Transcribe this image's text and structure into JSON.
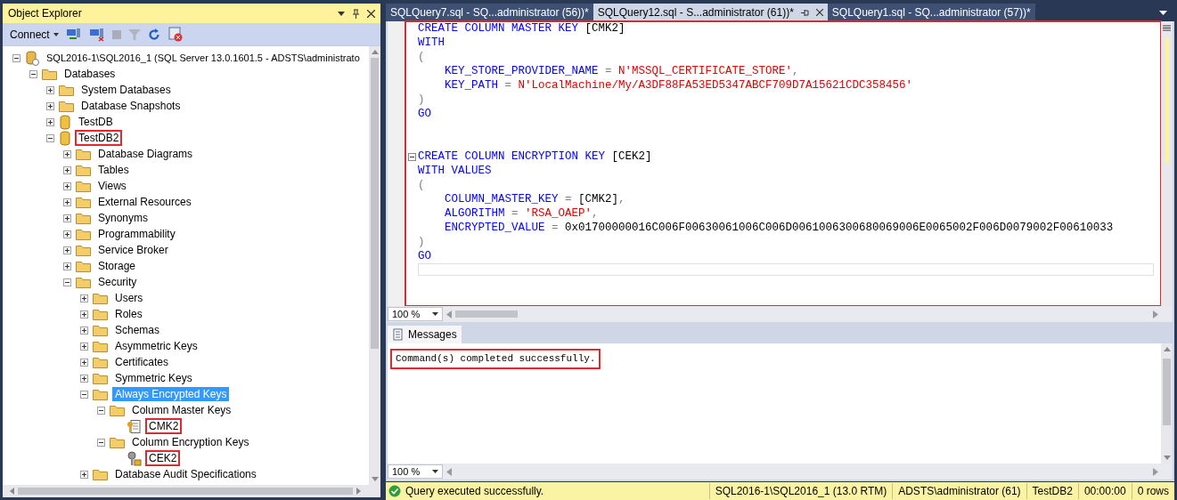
{
  "object_explorer": {
    "title": "Object Explorer",
    "toolbar": {
      "connect": "Connect"
    },
    "tree": [
      {
        "label": "SQL2016-1\\SQL2016_1 (SQL Server 13.0.1601.5 - ADSTS\\administrato",
        "kind": "server",
        "expanded": true,
        "selected": false,
        "highlighted": false,
        "children": [
          {
            "label": "Databases",
            "kind": "folder",
            "expanded": true,
            "selected": false,
            "highlighted": false,
            "children": [
              {
                "label": "System Databases",
                "kind": "folder",
                "expanded": false,
                "selected": false,
                "highlighted": false
              },
              {
                "label": "Database Snapshots",
                "kind": "folder",
                "expanded": false,
                "selected": false,
                "highlighted": false
              },
              {
                "label": "TestDB",
                "kind": "database",
                "expanded": false,
                "selected": false,
                "highlighted": false
              },
              {
                "label": "TestDB2",
                "kind": "database",
                "expanded": true,
                "selected": false,
                "highlighted": true,
                "children": [
                  {
                    "label": "Database Diagrams",
                    "kind": "folder",
                    "expanded": false,
                    "selected": false,
                    "highlighted": false
                  },
                  {
                    "label": "Tables",
                    "kind": "folder",
                    "expanded": false,
                    "selected": false,
                    "highlighted": false
                  },
                  {
                    "label": "Views",
                    "kind": "folder",
                    "expanded": false,
                    "selected": false,
                    "highlighted": false
                  },
                  {
                    "label": "External Resources",
                    "kind": "folder",
                    "expanded": false,
                    "selected": false,
                    "highlighted": false
                  },
                  {
                    "label": "Synonyms",
                    "kind": "folder",
                    "expanded": false,
                    "selected": false,
                    "highlighted": false
                  },
                  {
                    "label": "Programmability",
                    "kind": "folder",
                    "expanded": false,
                    "selected": false,
                    "highlighted": false
                  },
                  {
                    "label": "Service Broker",
                    "kind": "folder",
                    "expanded": false,
                    "selected": false,
                    "highlighted": false
                  },
                  {
                    "label": "Storage",
                    "kind": "folder",
                    "expanded": false,
                    "selected": false,
                    "highlighted": false
                  },
                  {
                    "label": "Security",
                    "kind": "folder",
                    "expanded": true,
                    "selected": false,
                    "highlighted": false,
                    "children": [
                      {
                        "label": "Users",
                        "kind": "folder",
                        "expanded": false,
                        "selected": false,
                        "highlighted": false
                      },
                      {
                        "label": "Roles",
                        "kind": "folder",
                        "expanded": false,
                        "selected": false,
                        "highlighted": false
                      },
                      {
                        "label": "Schemas",
                        "kind": "folder",
                        "expanded": false,
                        "selected": false,
                        "highlighted": false
                      },
                      {
                        "label": "Asymmetric Keys",
                        "kind": "folder",
                        "expanded": false,
                        "selected": false,
                        "highlighted": false
                      },
                      {
                        "label": "Certificates",
                        "kind": "folder",
                        "expanded": false,
                        "selected": false,
                        "highlighted": false
                      },
                      {
                        "label": "Symmetric Keys",
                        "kind": "folder",
                        "expanded": false,
                        "selected": false,
                        "highlighted": false
                      },
                      {
                        "label": "Always Encrypted Keys",
                        "kind": "folder",
                        "expanded": true,
                        "selected": true,
                        "highlighted": false,
                        "children": [
                          {
                            "label": "Column Master Keys",
                            "kind": "folder",
                            "expanded": true,
                            "selected": false,
                            "highlighted": false,
                            "children": [
                              {
                                "label": "CMK2",
                                "kind": "master_key",
                                "selected": false,
                                "highlighted": true
                              }
                            ]
                          },
                          {
                            "label": "Column Encryption Keys",
                            "kind": "folder",
                            "expanded": true,
                            "selected": false,
                            "highlighted": false,
                            "children": [
                              {
                                "label": "CEK2",
                                "kind": "encryption_key",
                                "selected": false,
                                "highlighted": true
                              }
                            ]
                          }
                        ]
                      },
                      {
                        "label": "Database Audit Specifications",
                        "kind": "folder",
                        "expanded": false,
                        "selected": false,
                        "highlighted": false
                      }
                    ]
                  }
                ]
              }
            ]
          }
        ]
      }
    ]
  },
  "tabs": [
    {
      "label": "SQLQuery7.sql - SQ...administrator (56))*",
      "selected": false
    },
    {
      "label": "SQLQuery12.sql - S...administrator (61))*",
      "selected": true
    },
    {
      "label": "SQLQuery1.sql - SQ...administrator (57))*",
      "selected": false
    }
  ],
  "editor": {
    "highlighted": true,
    "zoom": "100 %",
    "lines": [
      {
        "fold": false,
        "tokens": [
          {
            "text": "CREATE COLUMN MASTER KEY ",
            "kind": "kw"
          },
          {
            "text": "[CMK2]",
            "kind": "plain"
          }
        ]
      },
      {
        "fold": false,
        "tokens": [
          {
            "text": "WITH",
            "kind": "kw"
          }
        ]
      },
      {
        "fold": false,
        "tokens": [
          {
            "text": "(",
            "kind": "op"
          }
        ]
      },
      {
        "fold": false,
        "tokens": [
          {
            "text": "    KEY_STORE_PROVIDER_NAME ",
            "kind": "kw"
          },
          {
            "text": "= ",
            "kind": "op"
          },
          {
            "text": "N'MSSQL_CERTIFICATE_STORE'",
            "kind": "str"
          },
          {
            "text": ",",
            "kind": "op"
          }
        ]
      },
      {
        "fold": false,
        "tokens": [
          {
            "text": "    KEY_PATH ",
            "kind": "kw"
          },
          {
            "text": "= ",
            "kind": "op"
          },
          {
            "text": "N'LocalMachine/My/A3DF88FA53ED5347ABCF709D7A15621CDC358456'",
            "kind": "str"
          }
        ]
      },
      {
        "fold": false,
        "tokens": [
          {
            "text": ")",
            "kind": "op"
          }
        ]
      },
      {
        "fold": false,
        "tokens": [
          {
            "text": "GO",
            "kind": "kw"
          }
        ]
      },
      {
        "fold": false
      },
      {
        "fold": false
      },
      {
        "fold": true,
        "tokens": [
          {
            "text": "CREATE COLUMN ENCRYPTION KEY ",
            "kind": "kw"
          },
          {
            "text": "[CEK2]",
            "kind": "plain"
          }
        ]
      },
      {
        "fold": false,
        "tokens": [
          {
            "text": "WITH VALUES",
            "kind": "kw"
          }
        ]
      },
      {
        "fold": false,
        "tokens": [
          {
            "text": "(",
            "kind": "op"
          }
        ]
      },
      {
        "fold": false,
        "tokens": [
          {
            "text": "    COLUMN_MASTER_KEY ",
            "kind": "kw"
          },
          {
            "text": "= ",
            "kind": "op"
          },
          {
            "text": "[CMK2]",
            "kind": "plain"
          },
          {
            "text": ",",
            "kind": "op"
          }
        ]
      },
      {
        "fold": false,
        "tokens": [
          {
            "text": "    ALGORITHM ",
            "kind": "kw"
          },
          {
            "text": "= ",
            "kind": "op"
          },
          {
            "text": "'RSA_OAEP'",
            "kind": "str"
          },
          {
            "text": ",",
            "kind": "op"
          }
        ]
      },
      {
        "fold": false,
        "tokens": [
          {
            "text": "    ENCRYPTED_VALUE ",
            "kind": "kw"
          },
          {
            "text": "= ",
            "kind": "op"
          },
          {
            "text": "0x01700000016C006F00630061006C006D0061006300680069006E0065002F006D0079002F00610033",
            "kind": "plain"
          }
        ]
      },
      {
        "fold": false,
        "tokens": [
          {
            "text": ")",
            "kind": "op"
          }
        ]
      },
      {
        "fold": false,
        "tokens": [
          {
            "text": "GO",
            "kind": "kw"
          }
        ]
      }
    ]
  },
  "results": {
    "tab": "Messages",
    "message": "Command(s) completed successfully.",
    "highlighted": true,
    "zoom": "100 %"
  },
  "status_bar": [
    {
      "text": "Query executed successfully.",
      "kind": "success"
    },
    {
      "text": "SQL2016-1\\SQL2016_1 (13.0 RTM)",
      "kind": "info"
    },
    {
      "text": "ADSTS\\administrator (61)",
      "kind": "info"
    },
    {
      "text": "TestDB2",
      "kind": "info"
    },
    {
      "text": "00:00:00",
      "kind": "info"
    },
    {
      "text": "0 rows",
      "kind": "info"
    }
  ]
}
